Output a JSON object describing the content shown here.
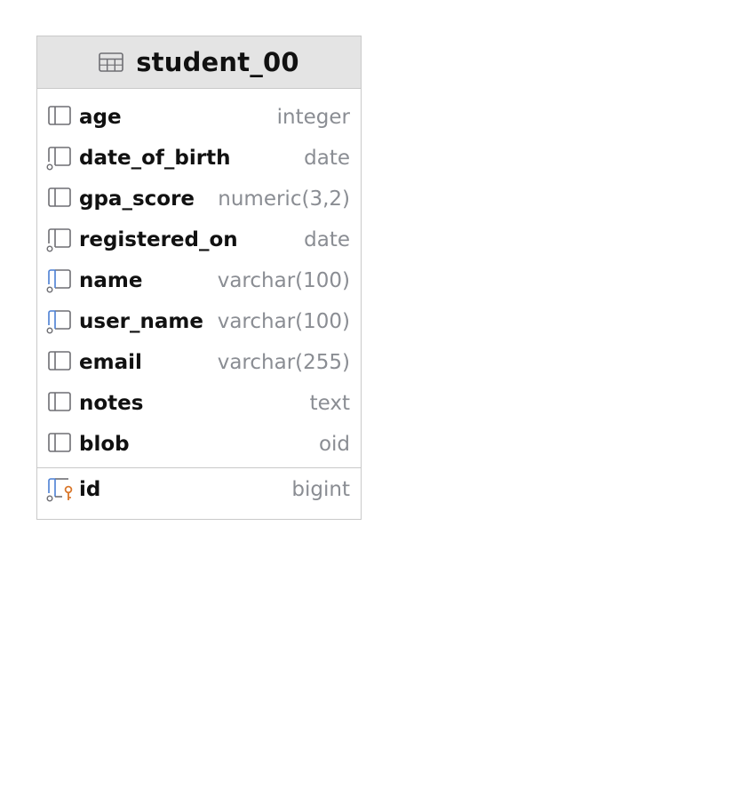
{
  "entity": {
    "title": "student_00",
    "columns": [
      {
        "name": "age",
        "type": "integer",
        "icon": "column-icon"
      },
      {
        "name": "date_of_birth",
        "type": "date",
        "icon": "nullable-column-icon"
      },
      {
        "name": "gpa_score",
        "type": "numeric(3,2)",
        "icon": "column-icon"
      },
      {
        "name": "registered_on",
        "type": "date",
        "icon": "nullable-column-icon"
      },
      {
        "name": "name",
        "type": "varchar(100)",
        "icon": "nullable-text-column-icon"
      },
      {
        "name": "user_name",
        "type": "varchar(100)",
        "icon": "nullable-text-column-icon"
      },
      {
        "name": "email",
        "type": "varchar(255)",
        "icon": "column-icon"
      },
      {
        "name": "notes",
        "type": "text",
        "icon": "column-icon"
      },
      {
        "name": "blob",
        "type": "oid",
        "icon": "column-icon"
      }
    ],
    "primary_key": [
      {
        "name": "id",
        "type": "bigint",
        "icon": "primary-key-column-icon"
      }
    ]
  },
  "colors": {
    "icon_gray": "#6e6e73",
    "icon_blue": "#4a7fd4",
    "key_orange": "#d9772b",
    "type_gray": "#8a8d93",
    "header_bg": "#e4e4e4",
    "border": "#c9c9c9"
  }
}
